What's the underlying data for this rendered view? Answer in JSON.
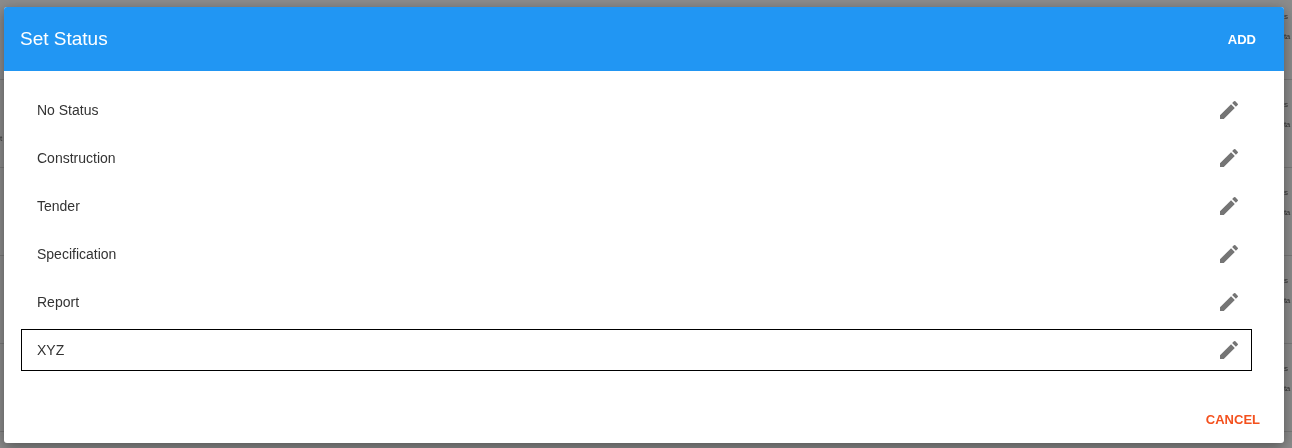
{
  "backdrop": {
    "rows": [
      {
        "left": "",
        "right_top": "s",
        "right_bottom": "ta"
      },
      {
        "left": "t",
        "right_top": "s",
        "right_bottom": "ta"
      },
      {
        "left": "",
        "right_top": "s",
        "right_bottom": "ta"
      },
      {
        "left": "",
        "right_top": "s",
        "right_bottom": "ta"
      },
      {
        "left": "",
        "right_top": "s",
        "right_bottom": "ta"
      }
    ]
  },
  "dialog": {
    "title": "Set Status",
    "add_button": "ADD",
    "items": [
      {
        "label": "No Status",
        "selected": false
      },
      {
        "label": "Construction",
        "selected": false
      },
      {
        "label": "Tender",
        "selected": false
      },
      {
        "label": "Specification",
        "selected": false
      },
      {
        "label": "Report",
        "selected": false
      },
      {
        "label": "XYZ",
        "selected": true
      }
    ],
    "cancel_button": "CANCEL"
  }
}
